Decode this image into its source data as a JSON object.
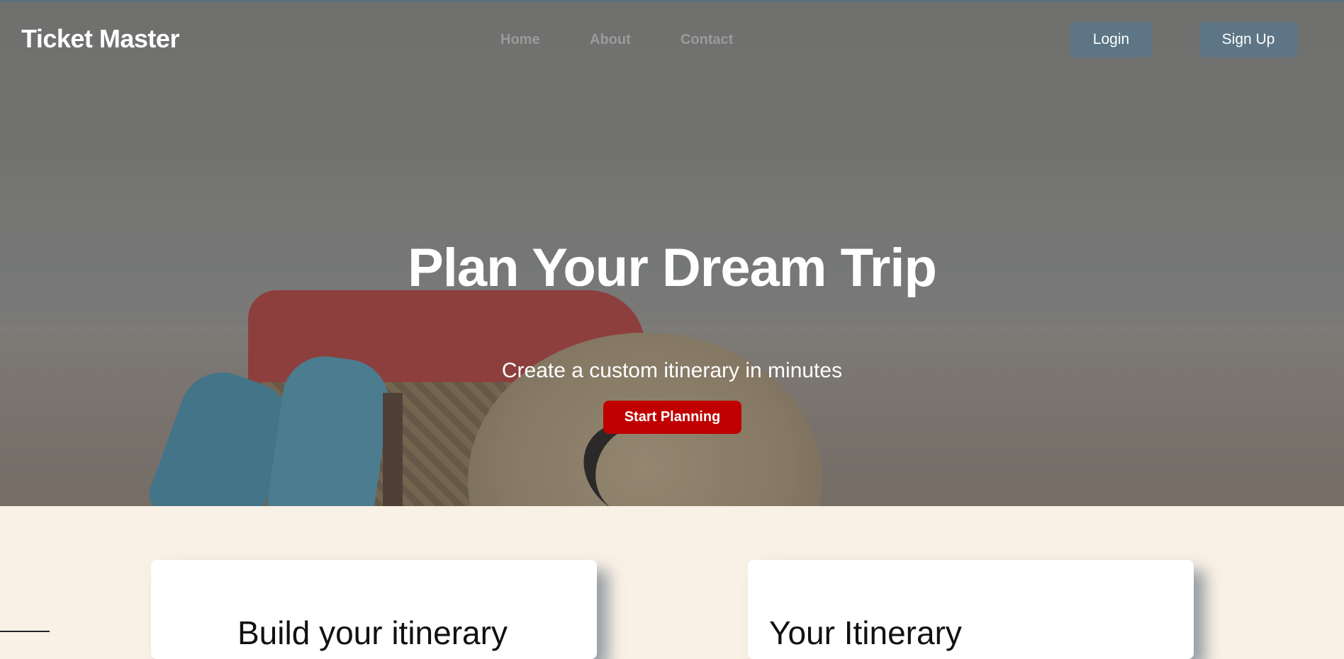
{
  "nav": {
    "brand": "Ticket Master",
    "links": [
      {
        "label": "Home"
      },
      {
        "label": "About"
      },
      {
        "label": "Contact"
      }
    ],
    "login_label": "Login",
    "signup_label": "Sign Up"
  },
  "hero": {
    "title": "Plan Your Dream Trip",
    "subtitle": "Create a custom itinerary in minutes",
    "cta_label": "Start Planning"
  },
  "cards": [
    {
      "title": "Build your itinerary"
    },
    {
      "title": "Your Itinerary"
    }
  ],
  "colors": {
    "page_background": "#faf1e6",
    "auth_button": "#5d7585",
    "cta_button": "#c00000",
    "nav_link": "#9a9a9a"
  }
}
